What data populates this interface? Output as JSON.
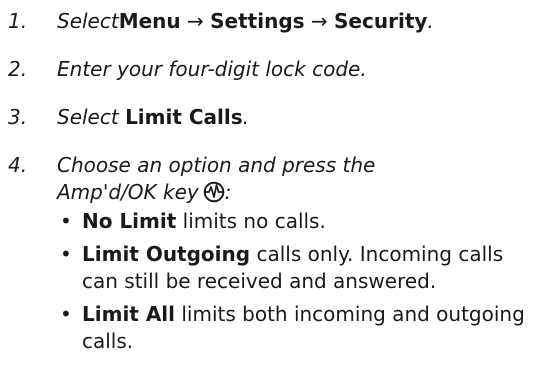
{
  "steps": [
    {
      "number": "1.",
      "parts": {
        "prefix": "Select",
        "menu": "Menu",
        "arrow1": "→",
        "settings": "Settings",
        "arrow2": "→",
        "security": "Security",
        "end": "."
      }
    },
    {
      "number": "2.",
      "text": "Enter your four-digit lock code."
    },
    {
      "number": "3.",
      "parts": {
        "prefix": "Select ",
        "bold": "Limit Calls",
        "end": "."
      }
    },
    {
      "number": "4.",
      "line1": "Choose an option and press the",
      "line2": "Amp'd/OK key",
      "end": ":",
      "icon": "ampd-ok-key-icon"
    }
  ],
  "options": [
    {
      "bullet": "•",
      "bold": "No Limit",
      "text": " limits no calls."
    },
    {
      "bullet": "•",
      "bold": "Limit Outgoing",
      "text": " calls only. Incoming calls can still be received and answered."
    },
    {
      "bullet": "•",
      "bold": "Limit All",
      "text": " limits both incoming and outgoing calls."
    }
  ]
}
